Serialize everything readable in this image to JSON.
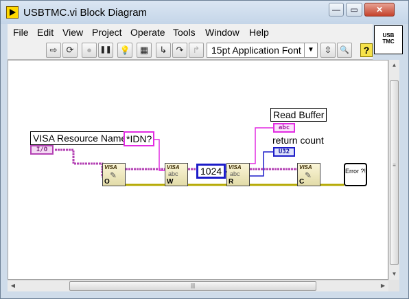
{
  "window": {
    "title": "USBTMC.vi Block Diagram",
    "minimize_glyph": "—",
    "restore_glyph": "▭",
    "close_glyph": "✕"
  },
  "menu": [
    "File",
    "Edit",
    "View",
    "Project",
    "Operate",
    "Tools",
    "Window",
    "Help"
  ],
  "toolbar": {
    "run_glyph": "⇨",
    "run_continuous_glyph": "⟳",
    "abort_glyph": "●",
    "pause_glyph": "❚❚",
    "highlight_glyph": "💡",
    "retain_glyph": "▦",
    "step_into_glyph": "↳",
    "step_over_glyph": "↷",
    "step_out_glyph": "↱",
    "font_label": "15pt Application Font",
    "dropdown_glyph": "▼",
    "cleanup_glyph": "⇳",
    "search_glyph": "🔍",
    "help_glyph": "?"
  },
  "vi_icon_text": [
    "USB",
    "TMC"
  ],
  "diagram": {
    "resource_label": "VISA Resource Name",
    "resource_terminal": "I/O",
    "idn_constant": "*IDN?",
    "count_constant": "1024",
    "read_buffer_label": "Read Buffer",
    "read_buffer_terminal": "abc",
    "return_count_label": "return count",
    "return_count_terminal": "U32",
    "nodes": [
      {
        "top": "VISA",
        "letter": "O",
        "glyph": "✎"
      },
      {
        "top": "VISA",
        "letter": "W",
        "glyph": "abc"
      },
      {
        "top": "VISA",
        "letter": "R",
        "glyph": "abc"
      },
      {
        "top": "VISA",
        "letter": "C",
        "glyph": "✎"
      }
    ],
    "error_text": "Error ?!"
  },
  "colors": {
    "visa_wire": "#b442b4",
    "error_wire": "#b4a800",
    "string_wire": "#e22ce2",
    "numeric_wire": "#1c1cc8"
  }
}
